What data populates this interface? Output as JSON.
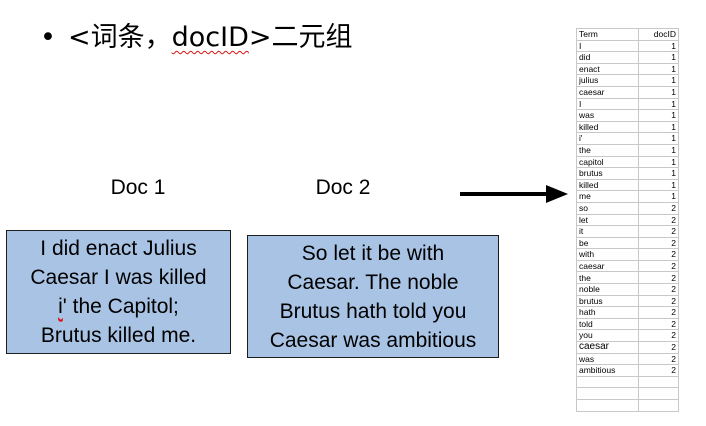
{
  "heading": {
    "bullet": "•",
    "prefix": "<词条，",
    "docid": "docID",
    "suffix": ">二元组"
  },
  "docs": [
    {
      "label": "Doc 1",
      "lines": [
        "I did enact Julius",
        "Caesar I was killed",
        "i' the Capitol;",
        "Brutus killed me."
      ]
    },
    {
      "label": "Doc 2",
      "lines": [
        "So let it be with",
        "Caesar. The noble",
        "Brutus hath told you",
        "Caesar was ambitious"
      ]
    }
  ],
  "table": {
    "headers": [
      "Term",
      "docID"
    ],
    "rows": [
      [
        "I",
        "1"
      ],
      [
        "did",
        "1"
      ],
      [
        "enact",
        "1"
      ],
      [
        "julius",
        "1"
      ],
      [
        "caesar",
        "1"
      ],
      [
        "I",
        "1"
      ],
      [
        "was",
        "1"
      ],
      [
        "killed",
        "1"
      ],
      [
        "i'",
        "1"
      ],
      [
        "the",
        "1"
      ],
      [
        "capitol",
        "1"
      ],
      [
        "brutus",
        "1"
      ],
      [
        "killed",
        "1"
      ],
      [
        "me",
        "1"
      ],
      [
        "so",
        "2"
      ],
      [
        "let",
        "2"
      ],
      [
        "it",
        "2"
      ],
      [
        "be",
        "2"
      ],
      [
        "with",
        "2"
      ],
      [
        "caesar",
        "2"
      ],
      [
        "the",
        "2"
      ],
      [
        "noble",
        "2"
      ],
      [
        "brutus",
        "2"
      ],
      [
        "hath",
        "2"
      ],
      [
        "told",
        "2"
      ],
      [
        "you",
        "2"
      ],
      [
        "caesar",
        "2"
      ],
      [
        "was",
        "2"
      ],
      [
        "ambitious",
        "2"
      ]
    ],
    "empty_rows": 3
  },
  "colors": {
    "doc_box_fill": "#a9c3e4",
    "arrow": "#000000",
    "grid": "#c8c8c8"
  }
}
